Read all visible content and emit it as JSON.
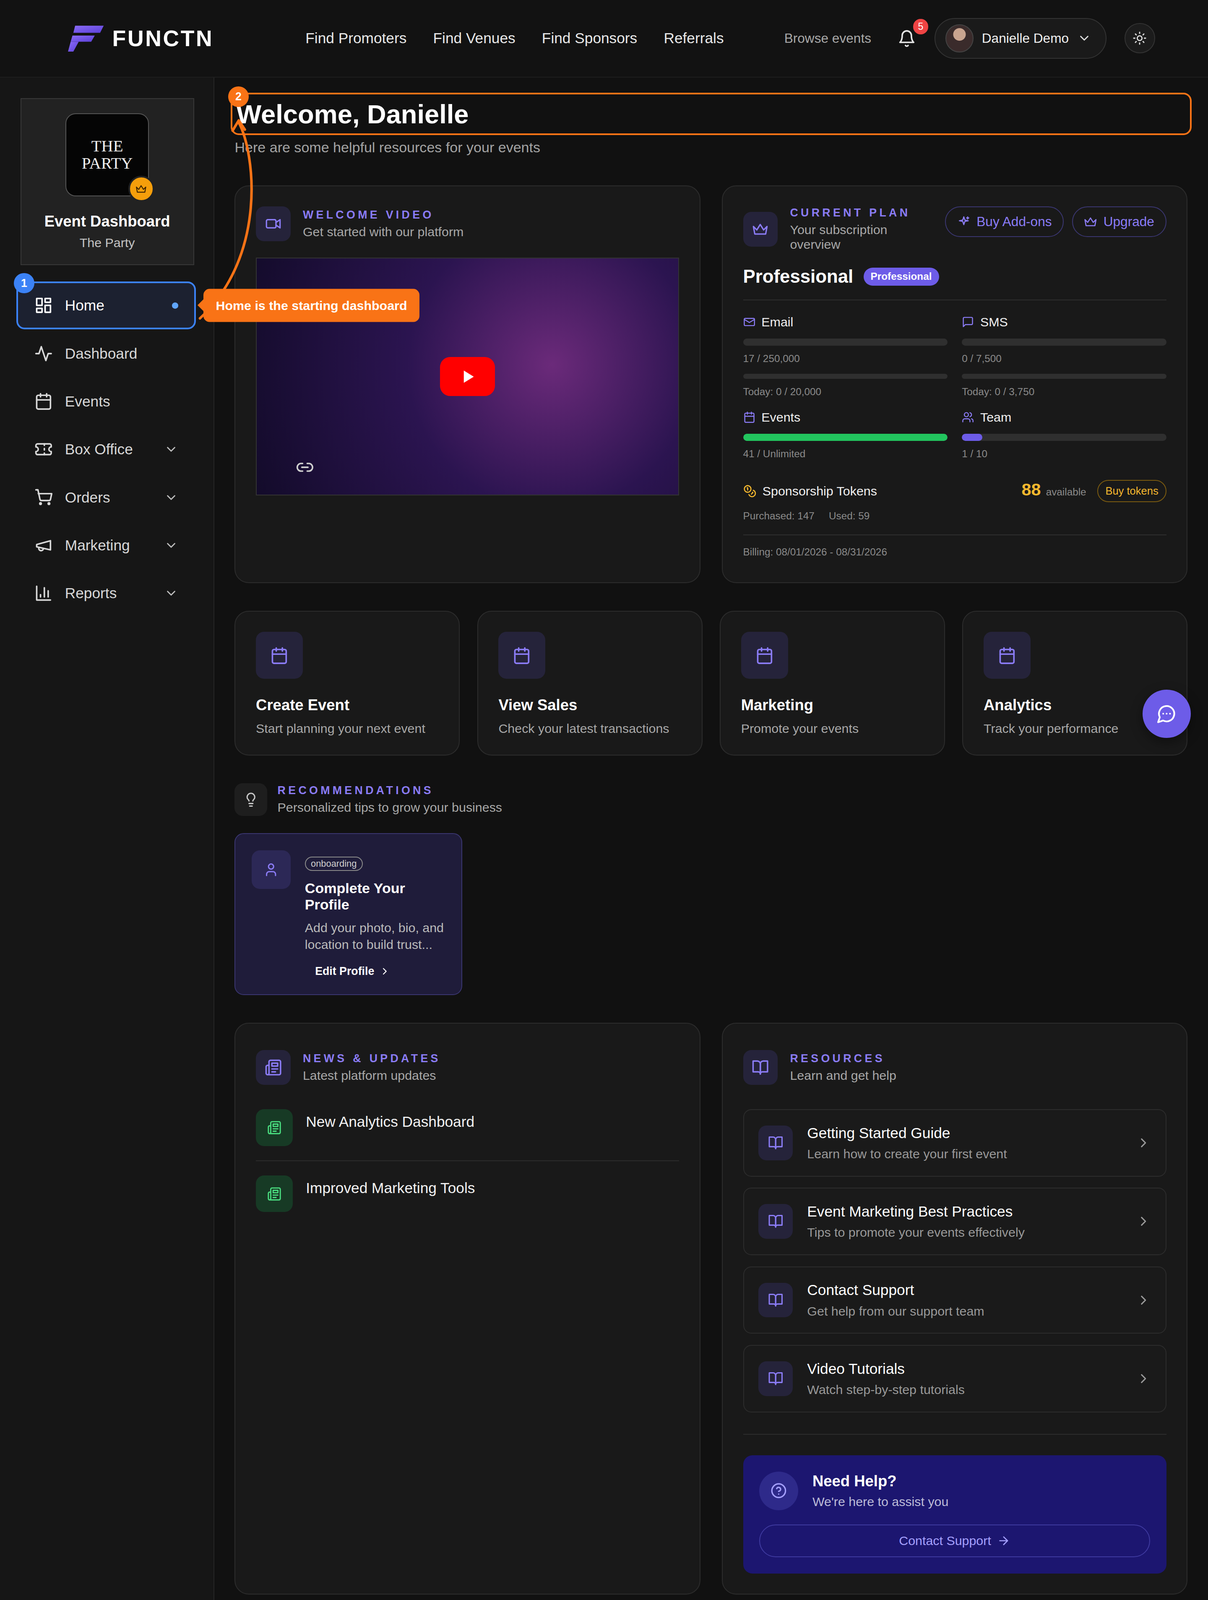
{
  "topbar": {
    "logo": "FUNCTN",
    "nav": [
      "Find Promoters",
      "Find Venues",
      "Find Sponsors",
      "Referrals"
    ],
    "browse": "Browse events",
    "notifications": "5",
    "user": "Danielle Demo"
  },
  "sidebar": {
    "logo_text": "THE PARTY",
    "title": "Event Dashboard",
    "subtitle": "The Party",
    "items": [
      {
        "label": "Home",
        "selected": true,
        "expandable": false
      },
      {
        "label": "Dashboard",
        "selected": false,
        "expandable": false
      },
      {
        "label": "Events",
        "selected": false,
        "expandable": false
      },
      {
        "label": "Box Office",
        "selected": false,
        "expandable": true
      },
      {
        "label": "Orders",
        "selected": false,
        "expandable": true
      },
      {
        "label": "Marketing",
        "selected": false,
        "expandable": true
      },
      {
        "label": "Reports",
        "selected": false,
        "expandable": true
      }
    ]
  },
  "tour": {
    "home_step": "1",
    "heading_step": "2",
    "tooltip": "Home is the starting dashboard"
  },
  "heading": {
    "title": "Welcome, Danielle",
    "subtitle": "Here are some helpful resources for your events"
  },
  "video": {
    "eyebrow": "WELCOME VIDEO",
    "subtitle": "Get started with our platform"
  },
  "plan": {
    "eyebrow": "CURRENT PLAN",
    "subtitle": "Your subscription overview",
    "buttons": [
      "Buy Add-ons",
      "Upgrade"
    ],
    "name": "Professional",
    "badge": "Professional",
    "meters": [
      {
        "name": "Email",
        "level": 0.0001,
        "reading": "17 / 250,000",
        "color": "#8b7cf6",
        "daily": {
          "level": 0,
          "reading": "Today: 0 / 20,000"
        }
      },
      {
        "name": "SMS",
        "level": 0,
        "reading": "0 / 7,500",
        "color": "#8b7cf6",
        "daily": {
          "level": 0,
          "reading": "Today: 0 / 3,750"
        }
      },
      {
        "name": "Events",
        "level": 1,
        "reading": "41 / Unlimited",
        "color": "#22c55e"
      },
      {
        "name": "Team",
        "level": 0.1,
        "reading": "1 / 10",
        "color": "#6d5ce8"
      }
    ],
    "tokens": {
      "label": "Sponsorship Tokens",
      "available": "88",
      "available_label": "available",
      "button": "Buy tokens",
      "purchased": "Purchased: 147",
      "used": "Used: 59"
    },
    "billing": "Billing: 08/01/2026 - 08/31/2026"
  },
  "quick_actions": [
    {
      "title": "Create Event",
      "text": "Start planning your next event"
    },
    {
      "title": "View Sales",
      "text": "Check your latest transactions"
    },
    {
      "title": "Marketing",
      "text": "Promote your events"
    },
    {
      "title": "Analytics",
      "text": "Track your performance"
    }
  ],
  "recommendations": {
    "eyebrow": "RECOMMENDATIONS",
    "subtitle": "Personalized tips to grow your business",
    "cards": [
      {
        "tag": "onboarding",
        "title": "Complete Your Profile",
        "text": "Add your photo, bio, and location to build trust...",
        "link": "Edit Profile"
      }
    ]
  },
  "news": {
    "eyebrow": "NEWS & UPDATES",
    "subtitle": "Latest platform updates",
    "items": [
      "New Analytics Dashboard",
      "Improved Marketing Tools"
    ]
  },
  "resources": {
    "eyebrow": "RESOURCES",
    "subtitle": "Learn and get help",
    "items": [
      {
        "title": "Getting Started Guide",
        "text": "Learn how to create your first event"
      },
      {
        "title": "Event Marketing Best Practices",
        "text": "Tips to promote your events effectively"
      },
      {
        "title": "Contact Support",
        "text": "Get help from our support team"
      },
      {
        "title": "Video Tutorials",
        "text": "Watch step-by-step tutorials"
      }
    ]
  },
  "help": {
    "title": "Need Help?",
    "subtitle": "We're here to assist you",
    "button": "Contact Support"
  }
}
